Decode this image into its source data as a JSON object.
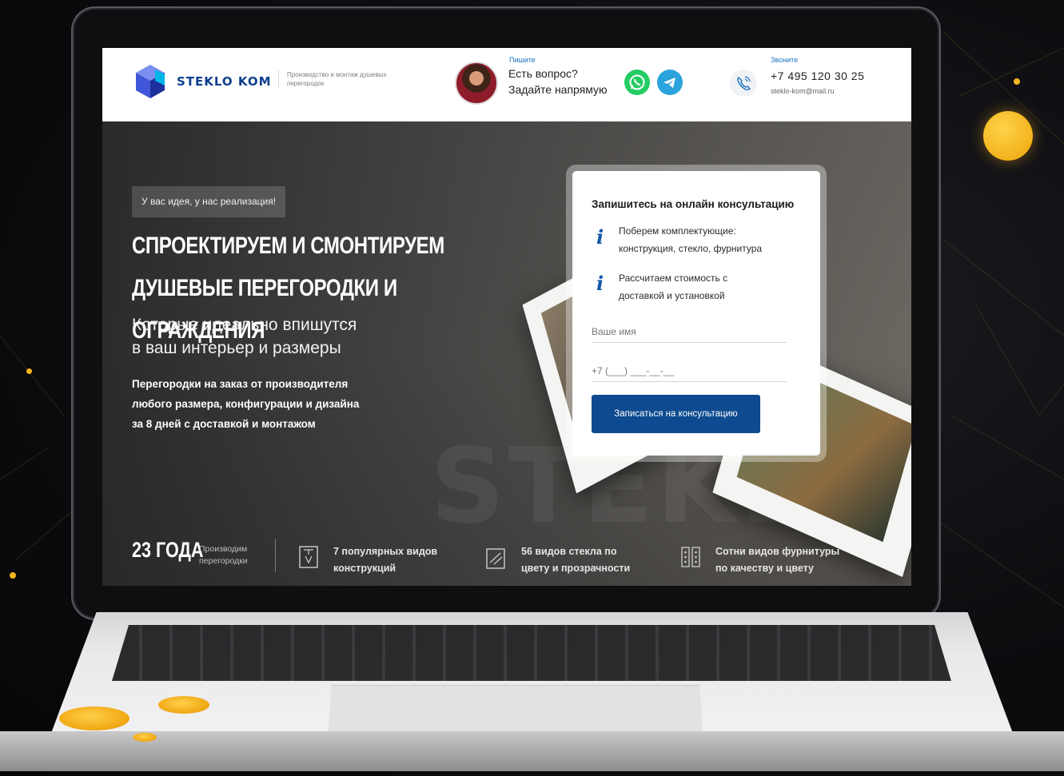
{
  "brand": {
    "name": "STEKLO KOM",
    "tagline": "Производство и монтаж душевых перегородок",
    "accent": "#0c3f8d"
  },
  "header": {
    "write_label": "Пишите",
    "question_line1": "Есть вопрос?",
    "question_line2": "Задайте напрямую",
    "whatsapp_color": "#24cc64",
    "telegram_color": "#2ba3dc",
    "call_label": "Звоните",
    "phone": "+7 495 120 30 25",
    "email": "steklo-kom@mail.ru"
  },
  "hero": {
    "badge": "У вас идея, у нас реализация!",
    "title_line1": "СПРОЕКТИРУЕМ И СМОНТИРУЕМ",
    "title_line2": "ДУШЕВЫЕ ПЕРЕГОРОДКИ И ОГРАЖДЕНИЯ",
    "subtitle_line1": "Которые идеально впишутся",
    "subtitle_line2": "в ваш интерьер и размеры",
    "desc_line1": "Перегородки на заказ от производителя",
    "desc_line2": "любого размера, конфигурации и дизайна",
    "desc_line3": "за 8 дней с доставкой и монтажом",
    "watermark": "STEKLO KOM"
  },
  "form": {
    "title": "Запишитесь на онлайн консультацию",
    "info1_line1": "Поберем комплектующие:",
    "info1_line2": "конструкция, стекло, фурнитура",
    "info2_line1": "Рассчитаем стоимость с",
    "info2_line2": "доставкой и установкой",
    "name_placeholder": "Ваше имя",
    "phone_placeholder": "+7 (___) ___-__-__",
    "submit_label": "Записаться на консультацию",
    "submit_color": "#0d4a8f"
  },
  "stats": {
    "years_value": "23 ГОДА",
    "years_caption_line1": "Производим",
    "years_caption_line2": "перегородки",
    "items": [
      {
        "icon": "shower-cabin-icon",
        "line1": "7 популярных видов",
        "line2": "конструкций"
      },
      {
        "icon": "glass-pane-icon",
        "line1": "56 видов стекла по",
        "line2": "цвету и прозрачности"
      },
      {
        "icon": "hinge-hardware-icon",
        "line1": "Сотни видов фурнитуры",
        "line2": "по качеству и цвету"
      }
    ]
  }
}
